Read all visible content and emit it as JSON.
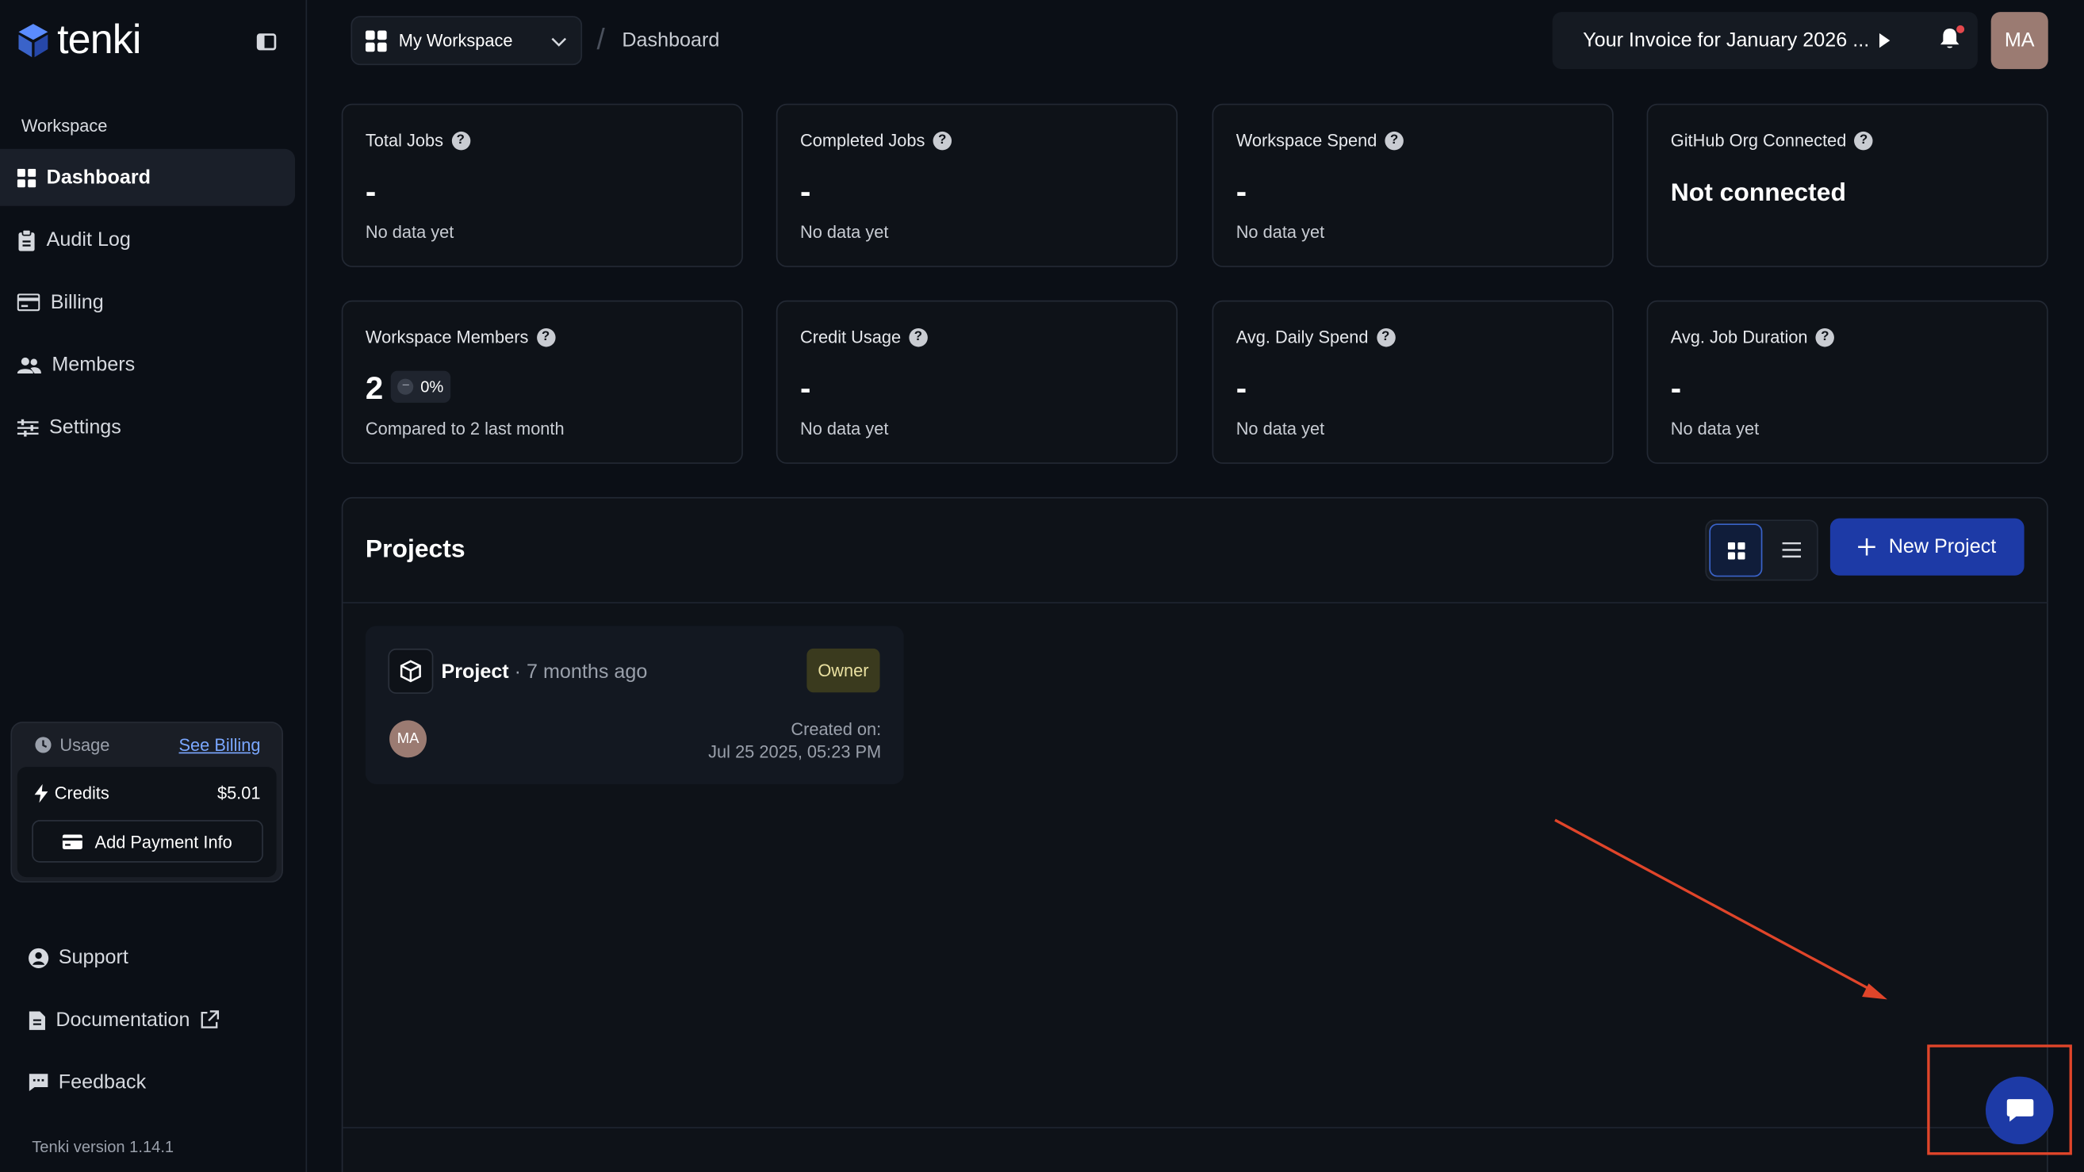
{
  "app": {
    "logo_text": "tenki",
    "version": "Tenki version 1.14.1"
  },
  "sidebar": {
    "section_label": "Workspace",
    "items": [
      {
        "label": "Dashboard",
        "icon": "grid-icon",
        "active": true
      },
      {
        "label": "Audit Log",
        "icon": "clipboard-icon"
      },
      {
        "label": "Billing",
        "icon": "credit-card-icon"
      },
      {
        "label": "Members",
        "icon": "users-icon"
      },
      {
        "label": "Settings",
        "icon": "sliders-icon"
      }
    ],
    "usage": {
      "label": "Usage",
      "see_billing": "See Billing",
      "credits_label": "Credits",
      "credits_value": "$5.01",
      "add_payment": "Add Payment Info"
    },
    "footer": [
      {
        "label": "Support",
        "icon": "lifebuoy-icon"
      },
      {
        "label": "Documentation",
        "icon": "document-icon"
      },
      {
        "label": "Feedback",
        "icon": "message-icon"
      }
    ]
  },
  "topbar": {
    "workspace": "My Workspace",
    "breadcrumb": "Dashboard",
    "invoice": "Your Invoice for January 2026 ...",
    "avatar_initials": "MA"
  },
  "stats": [
    {
      "title": "Total Jobs",
      "value": "-",
      "sub": "No data yet"
    },
    {
      "title": "Completed Jobs",
      "value": "-",
      "sub": "No data yet"
    },
    {
      "title": "Workspace Spend",
      "value": "-",
      "sub": "No data yet"
    },
    {
      "title": "GitHub Org Connected",
      "value": "Not connected",
      "sub": ""
    },
    {
      "title": "Workspace Members",
      "value": "2",
      "change": "0%",
      "sub": "Compared to 2 last month"
    },
    {
      "title": "Credit Usage",
      "value": "-",
      "sub": "No data yet"
    },
    {
      "title": "Avg. Daily Spend",
      "value": "-",
      "sub": "No data yet"
    },
    {
      "title": "Avg. Job Duration",
      "value": "-",
      "sub": "No data yet"
    }
  ],
  "projects": {
    "title": "Projects",
    "new_button": "New Project",
    "items": [
      {
        "name": "Project",
        "time": " · 7 months ago",
        "role": "Owner",
        "avatar": "MA",
        "created_label": "Created on:",
        "created_value": "Jul 25 2025, 05:23 PM"
      }
    ]
  },
  "colors": {
    "accent": "#1d3aa6",
    "annotation": "#e0452a",
    "owner_badge": "#3a3a1e"
  }
}
